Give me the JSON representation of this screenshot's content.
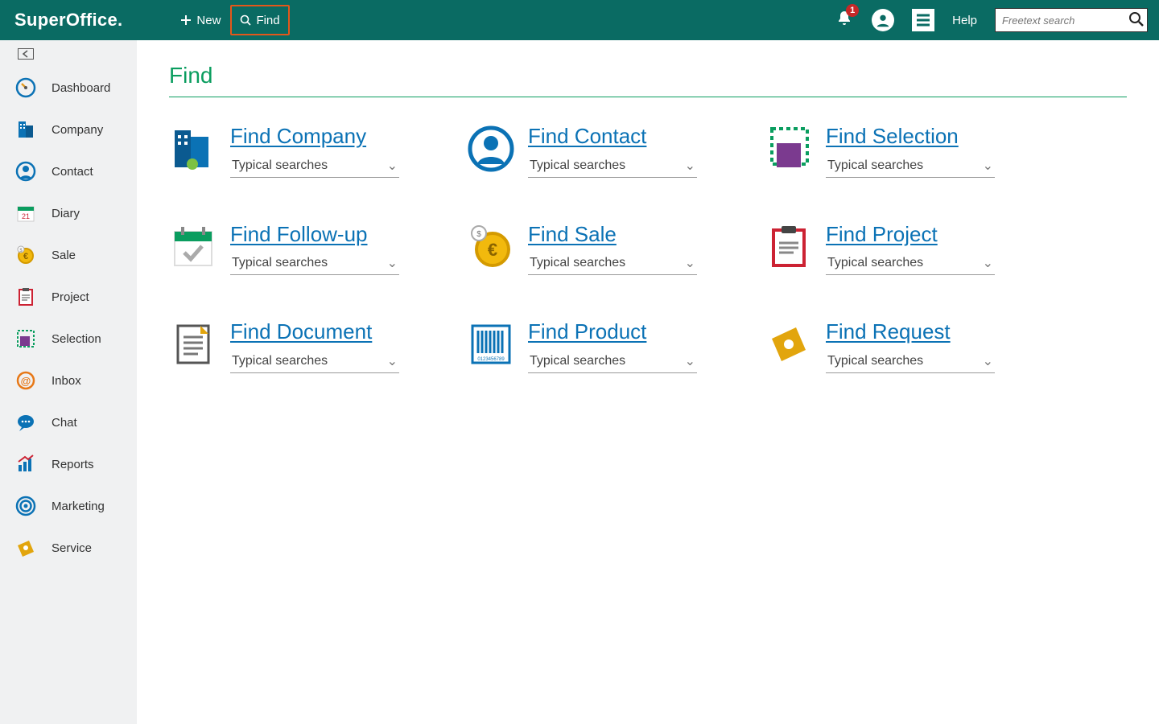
{
  "header": {
    "logo": "SuperOffice.",
    "new_label": "New",
    "find_label": "Find",
    "help_label": "Help",
    "notification_count": "1",
    "search_placeholder": "Freetext search"
  },
  "sidebar": {
    "items": [
      {
        "id": "dashboard",
        "label": "Dashboard"
      },
      {
        "id": "company",
        "label": "Company"
      },
      {
        "id": "contact",
        "label": "Contact"
      },
      {
        "id": "diary",
        "label": "Diary"
      },
      {
        "id": "sale",
        "label": "Sale"
      },
      {
        "id": "project",
        "label": "Project"
      },
      {
        "id": "selection",
        "label": "Selection"
      },
      {
        "id": "inbox",
        "label": "Inbox"
      },
      {
        "id": "chat",
        "label": "Chat"
      },
      {
        "id": "reports",
        "label": "Reports"
      },
      {
        "id": "marketing",
        "label": "Marketing"
      },
      {
        "id": "service",
        "label": "Service"
      }
    ]
  },
  "main": {
    "title": "Find",
    "typical_label": "Typical searches",
    "cards": [
      {
        "id": "company",
        "label": "Find Company"
      },
      {
        "id": "contact",
        "label": "Find Contact"
      },
      {
        "id": "selection",
        "label": "Find Selection"
      },
      {
        "id": "followup",
        "label": "Find Follow-up"
      },
      {
        "id": "sale",
        "label": "Find Sale"
      },
      {
        "id": "project",
        "label": "Find Project"
      },
      {
        "id": "document",
        "label": "Find Document"
      },
      {
        "id": "product",
        "label": "Find Product"
      },
      {
        "id": "request",
        "label": "Find Request"
      }
    ]
  },
  "colors": {
    "brand": "#0a6b63",
    "accent_green": "#0a9d5f",
    "link_blue": "#0b72b5",
    "highlight_orange": "#e4571a"
  }
}
